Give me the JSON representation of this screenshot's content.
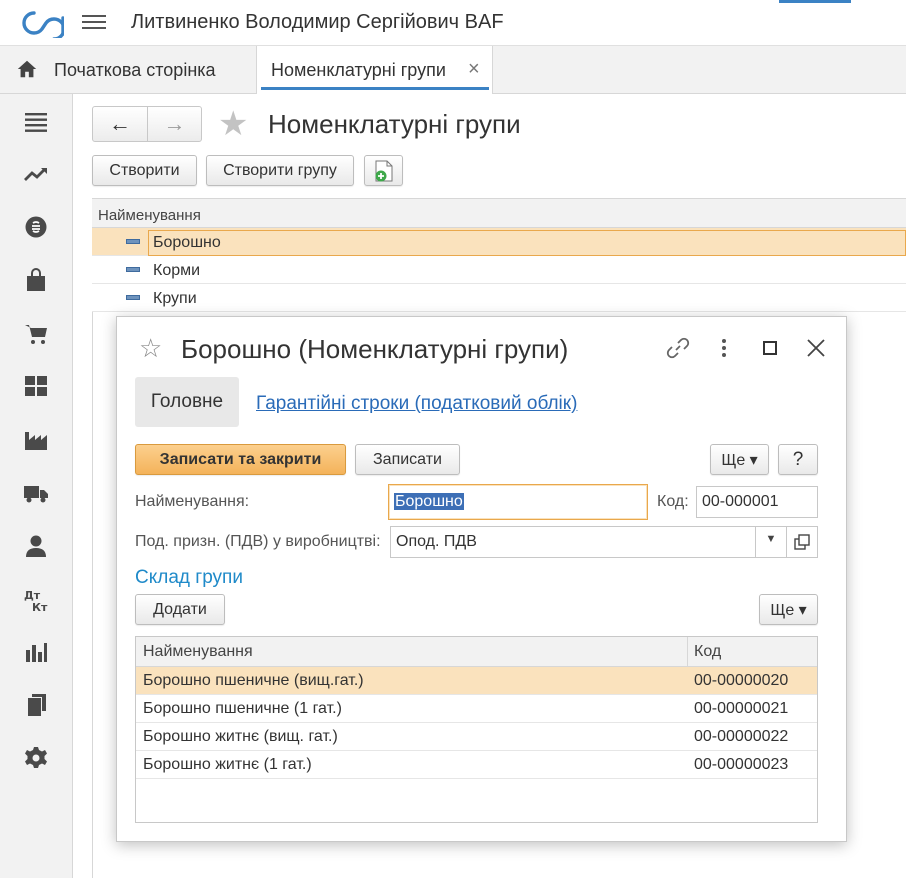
{
  "header": {
    "app_title": "Литвиненко Володимир Сергійович BAF"
  },
  "tabs": {
    "home_label": "Початкова сторінка",
    "groups_label": "Номенклатурні групи",
    "close_glyph": "×"
  },
  "sidebar": {
    "icons": [
      "menu-icon",
      "trend-icon",
      "money-icon",
      "bag-icon",
      "cart-icon",
      "warehouse-icon",
      "factory-icon",
      "truck-icon",
      "person-icon",
      "dt-kt-icon",
      "bar-chart-icon",
      "documents-icon",
      "gear-icon"
    ]
  },
  "main": {
    "title": "Номенклатурні групи",
    "nav_back": "←",
    "nav_forward": "→",
    "star": "★",
    "create_label": "Створити",
    "create_group_label": "Створити групу",
    "list": {
      "header": "Найменування",
      "rows": [
        {
          "name": "Борошно",
          "selected": true
        },
        {
          "name": "Корми",
          "selected": false
        },
        {
          "name": "Крупи",
          "selected": false
        }
      ]
    }
  },
  "dialog": {
    "star": "☆",
    "title": "Борошно (Номенклатурні групи)",
    "tab_main": "Головне",
    "tab_warranty": "Гарантійні строки (податковий облік)",
    "save_close_label": "Записати та закрити",
    "save_label": "Записати",
    "more_label": "Ще ▾",
    "help_label": "?",
    "name_label": "Найменування:",
    "name_value": "Борошно",
    "code_label": "Код:",
    "code_value": "00-000001",
    "vat_label": "Под. призн. (ПДВ) у виробництві:",
    "vat_value": "Опод. ПДВ",
    "composition_title": "Склад групи",
    "add_label": "Додати",
    "more2_label": "Ще ▾",
    "table": {
      "col_name": "Найменування",
      "col_code": "Код",
      "rows": [
        {
          "name": "Борошно пшеничне (вищ.гат.)",
          "code": "00-00000020",
          "selected": true
        },
        {
          "name": "Борошно пшеничне (1 гат.)",
          "code": "00-00000021",
          "selected": false
        },
        {
          "name": "Борошно житнє (вищ. гат.)",
          "code": "00-00000022",
          "selected": false
        },
        {
          "name": "Борошно житнє (1 гат.)",
          "code": "00-00000023",
          "selected": false
        }
      ]
    }
  },
  "colors": {
    "accent_blue": "#3b82c4",
    "selection": "#fae2bd",
    "primary_button": "#f4b35a",
    "link": "#2a6bb8"
  }
}
